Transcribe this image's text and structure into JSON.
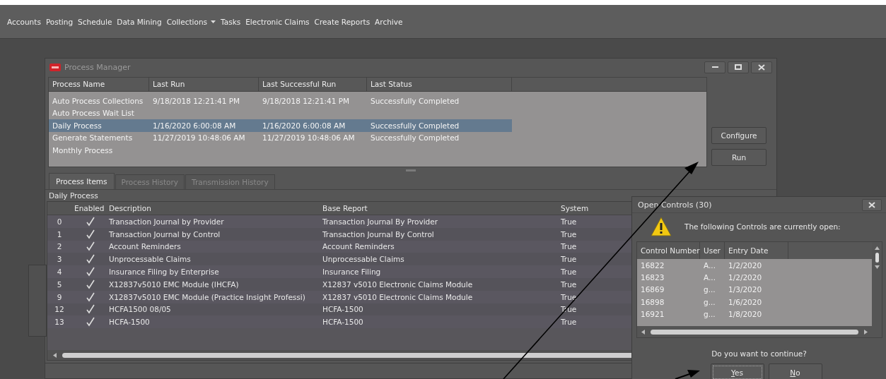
{
  "menu": [
    {
      "label": "Accounts",
      "dropdown": false
    },
    {
      "label": "Posting",
      "dropdown": false
    },
    {
      "label": "Schedule",
      "dropdown": false
    },
    {
      "label": "Data Mining",
      "dropdown": false
    },
    {
      "label": "Collections",
      "dropdown": true
    },
    {
      "label": "Tasks",
      "dropdown": false
    },
    {
      "label": "Electronic Claims",
      "dropdown": false
    },
    {
      "label": "Create Reports",
      "dropdown": false
    },
    {
      "label": "Archive",
      "dropdown": false
    }
  ],
  "process_manager": {
    "title": "Process Manager",
    "columns": [
      "Process Name",
      "Last Run",
      "Last Successful Run",
      "Last Status"
    ],
    "rows": [
      {
        "name": "Auto Process Collections",
        "last_run": "9/18/2018 12:21:41 PM",
        "last_successful_run": "9/18/2018 12:21:41 PM",
        "last_status": "Successfully Completed",
        "selected": false
      },
      {
        "name": "Auto Process Wait List",
        "selected": false
      },
      {
        "name": "Daily Process",
        "last_run": "1/16/2020 6:00:08 AM",
        "last_successful_run": "1/16/2020 6:00:08 AM",
        "last_status": "Successfully Completed",
        "selected": true
      },
      {
        "name": "Generate Statements",
        "last_run": "11/27/2019 10:48:06 AM",
        "last_successful_run": "11/27/2019 10:48:06 AM",
        "last_status": "Successfully Completed",
        "selected": false
      },
      {
        "name": "Monthly Process",
        "selected": false
      }
    ],
    "buttons": [
      "Configure",
      "Run"
    ],
    "tabs": [
      {
        "label": "Process Items",
        "selected": true
      },
      {
        "label": "Process History",
        "selected": false
      },
      {
        "label": "Transmission History",
        "selected": false
      }
    ],
    "group_label": "Daily Process",
    "items": {
      "columns": [
        "Enabled",
        "Description",
        "Base Report",
        "System"
      ],
      "rows": [
        {
          "index": "0",
          "enabled": true,
          "description": "Transaction Journal by Provider",
          "base_report": "Transaction Journal By Provider",
          "system": "True"
        },
        {
          "index": "1",
          "enabled": true,
          "description": "Transaction Journal by Control",
          "base_report": "Transaction Journal By Control",
          "system": "True"
        },
        {
          "index": "2",
          "enabled": true,
          "description": "Account Reminders",
          "base_report": "Account Reminders",
          "system": "True"
        },
        {
          "index": "3",
          "enabled": true,
          "description": "Unprocessable Claims",
          "base_report": "Unprocessable Claims",
          "system": "True"
        },
        {
          "index": "4",
          "enabled": true,
          "description": "Insurance Filing by Enterprise",
          "base_report": "Insurance Filing",
          "system": "True"
        },
        {
          "index": "5",
          "enabled": true,
          "description": "X12837v5010 EMC Module (IHCFA)",
          "base_report": "X12837 v5010 Electronic Claims Module",
          "system": "True"
        },
        {
          "index": "9",
          "enabled": true,
          "description": "X12837v5010 EMC Module (Practice Insight Professi)",
          "base_report": "X12837 v5010 Electronic Claims Module",
          "system": "True"
        },
        {
          "index": "12",
          "enabled": true,
          "description": "HCFA1500 08/05",
          "base_report": "HCFA-1500",
          "system": "True"
        },
        {
          "index": "13",
          "enabled": true,
          "description": "HCFA-1500",
          "base_report": "HCFA-1500",
          "system": "True"
        }
      ]
    }
  },
  "dialog": {
    "title": "Open Controls (30)",
    "message": "The following Controls are currently open:",
    "columns": [
      "Control Number",
      "User",
      "Entry Date"
    ],
    "rows": [
      {
        "control_number": "16822",
        "user": "A...",
        "entry_date": "1/2/2020"
      },
      {
        "control_number": "16823",
        "user": "A...",
        "entry_date": "1/2/2020"
      },
      {
        "control_number": "16869",
        "user": "g...",
        "entry_date": "1/3/2020"
      },
      {
        "control_number": "16898",
        "user": "g...",
        "entry_date": "1/6/2020"
      },
      {
        "control_number": "16921",
        "user": "g...",
        "entry_date": "1/8/2020"
      }
    ],
    "question": "Do you want to continue?",
    "buttons": [
      {
        "label": "Yes",
        "focused": true
      },
      {
        "label": "No",
        "focused": false
      }
    ]
  }
}
